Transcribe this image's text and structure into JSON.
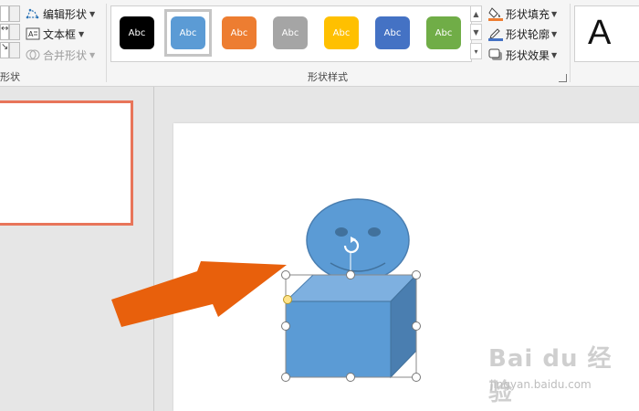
{
  "ribbon": {
    "insert_shapes": {
      "group_label": "形状",
      "tiny_glyphs": [
        "↔",
        "↘"
      ],
      "edit_shape": "编辑形状",
      "text_box": "文本框",
      "merge_shapes": "合并形状"
    },
    "shape_styles": {
      "group_label": "形状样式",
      "swatches": [
        {
          "label": "Abc",
          "color": "#000000"
        },
        {
          "label": "Abc",
          "color": "#5b9bd5"
        },
        {
          "label": "Abc",
          "color": "#ed7d31"
        },
        {
          "label": "Abc",
          "color": "#a5a5a5"
        },
        {
          "label": "Abc",
          "color": "#ffc000"
        },
        {
          "label": "Abc",
          "color": "#4472c4"
        },
        {
          "label": "Abc",
          "color": "#70ad47"
        }
      ],
      "selected_index": 1,
      "shape_fill": "形状填充",
      "shape_outline": "形状轮廓",
      "shape_effects": "形状效果"
    },
    "wordart": {
      "preview_letter": "A"
    }
  },
  "colors": {
    "accent_orange": "#e8755a",
    "arrow_orange": "#e8600c",
    "shape_blue": "#5b9bd5",
    "shape_blue_dark": "#4a7eb0",
    "shape_blue_light": "#7eb0e0"
  },
  "watermark": {
    "brand": "Bai du 经验",
    "url": "jingyan.baidu.com"
  }
}
